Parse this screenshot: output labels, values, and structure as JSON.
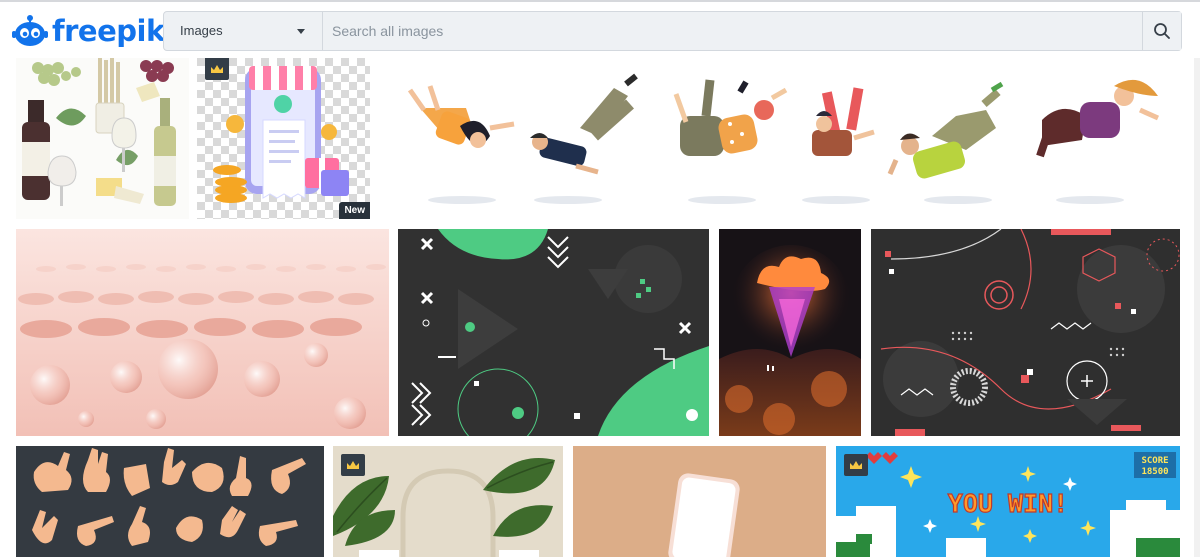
{
  "brand": {
    "name": "freepik",
    "color": "#1273eb"
  },
  "search": {
    "category": "Images",
    "placeholder": "Search all images"
  },
  "icons": {
    "logo": "freepik-robot-icon",
    "dropdown": "chevron-down-icon",
    "search": "search-icon",
    "premium": "crown-icon"
  },
  "tiles": [
    {
      "name": "tile-wine-cheese",
      "subject": "watercolor wine, grapes and cheese",
      "premium": false
    },
    {
      "name": "tile-phone-receipt",
      "subject": "3d phone payment receipt",
      "premium": true,
      "badge": "New"
    },
    {
      "name": "tile-falling-people",
      "subject": "people falling illustration",
      "premium": false
    },
    {
      "name": "tile-pink-bubbles",
      "subject": "pink 3d bubbles",
      "premium": false
    },
    {
      "name": "tile-memphis-green",
      "subject": "dark memphis background with green",
      "premium": false
    },
    {
      "name": "tile-fantasy-cloud",
      "subject": "fantasy mountain at night",
      "premium": false
    },
    {
      "name": "tile-memphis-red",
      "subject": "dark memphis background with red",
      "premium": false
    },
    {
      "name": "tile-hand-gestures",
      "subject": "hand gestures set",
      "premium": false
    },
    {
      "name": "tile-monstera-plants",
      "subject": "monstera plants on beige",
      "premium": true
    },
    {
      "name": "tile-phone-mockup",
      "subject": "phone mockup on tan background",
      "premium": false
    },
    {
      "name": "tile-you-win",
      "subject": "pixel game you win screen",
      "premium": true,
      "game_text": "YOU WIN!",
      "score_label": "SCORE",
      "score_value": "18500"
    }
  ]
}
